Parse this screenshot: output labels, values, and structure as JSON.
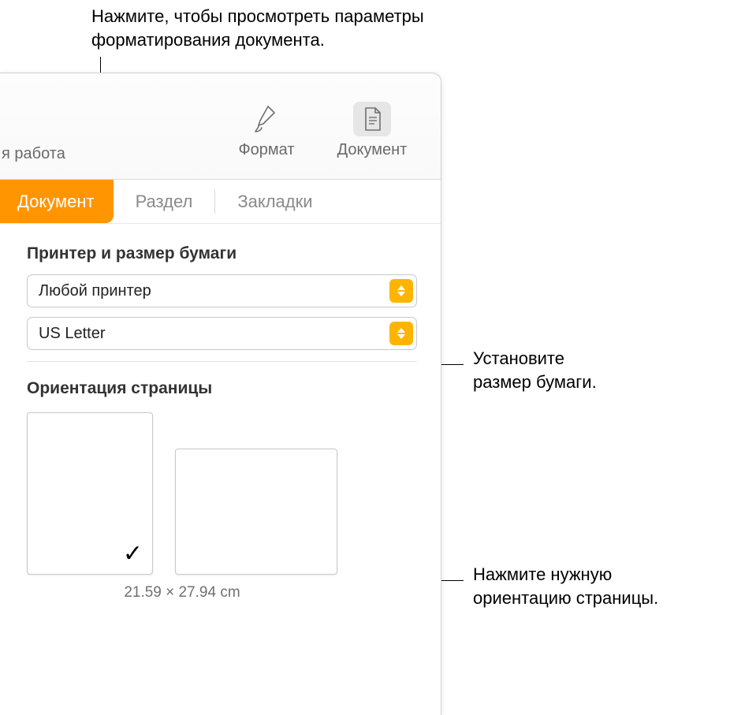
{
  "callouts": {
    "top": "Нажмите, чтобы просмотреть параметры\nформатирования документа.",
    "paper": "Установите\nразмер бумаги.",
    "orient": "Нажмите нужную\nориентацию страницы."
  },
  "toolbar": {
    "left_clip": "я работа",
    "format_label": "Формат",
    "document_label": "Документ"
  },
  "tabs": {
    "document": "Документ",
    "section": "Раздел",
    "bookmarks": "Закладки"
  },
  "printer_section": {
    "title": "Принтер и размер бумаги",
    "printer_value": "Любой принтер",
    "paper_value": "US Letter"
  },
  "orientation_section": {
    "title": "Ориентация страницы",
    "dimensions": "21.59 × 27.94 cm"
  }
}
